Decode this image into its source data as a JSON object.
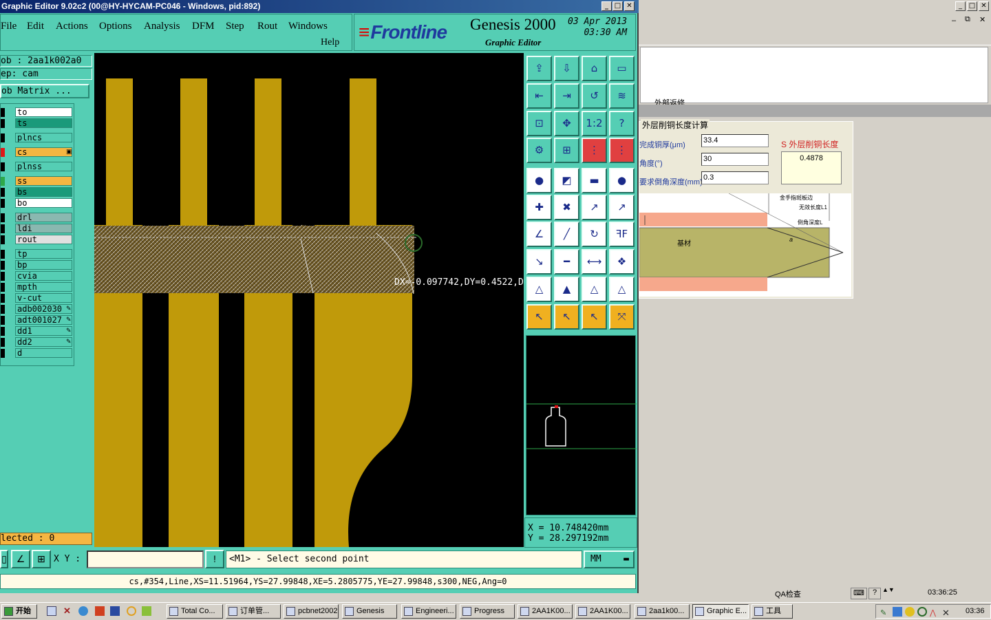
{
  "window": {
    "title": "Graphic Editor 9.02c2 (00@HY-HYCAM-PC046 - Windows, pid:892)",
    "controls": [
      "_",
      "□",
      "✕"
    ]
  },
  "menu": {
    "items": [
      "File",
      "Edit",
      "Actions",
      "Options",
      "Analysis",
      "DFM",
      "Step",
      "Rout",
      "Windows"
    ],
    "help": "Help"
  },
  "brand": {
    "logo": "Frontline",
    "product": "Genesis 2000",
    "subtitle": "Graphic Editor",
    "date": "03 Apr 2013",
    "time": "03:30 AM"
  },
  "job": {
    "job_line": "ob : 2aa1k002a0",
    "step_line": "ep: cam",
    "matrix_button": "ob Matrix ..."
  },
  "layers": [
    {
      "name": "to",
      "bg": "#ffffff",
      "sw": "#000000",
      "icon": ""
    },
    {
      "name": "ts",
      "bg": "#1a9a7a",
      "sw": "#000000",
      "icon": ""
    },
    {
      "name": "plncs",
      "bg": "#55ceb4",
      "sw": "#000000",
      "icon": ""
    },
    {
      "name": "cs",
      "bg": "#f5b642",
      "sw": "#e01818",
      "icon": "▣"
    },
    {
      "name": "plnss",
      "bg": "#55ceb4",
      "sw": "#000000",
      "icon": ""
    },
    {
      "name": "ss",
      "bg": "#f5b642",
      "sw": "#2ea84a",
      "icon": ""
    },
    {
      "name": "bs",
      "bg": "#1a9a7a",
      "sw": "#000000",
      "icon": ""
    },
    {
      "name": "bo",
      "bg": "#ffffff",
      "sw": "#000000",
      "icon": ""
    },
    {
      "name": "drl",
      "bg": "#8ab8b0",
      "sw": "#000000",
      "icon": ""
    },
    {
      "name": "ldi",
      "bg": "#8ab8b0",
      "sw": "#000000",
      "icon": ""
    },
    {
      "name": "rout",
      "bg": "#e0e0e0",
      "sw": "#000000",
      "icon": ""
    },
    {
      "name": "tp",
      "bg": "#55ceb4",
      "sw": "#000000",
      "icon": ""
    },
    {
      "name": "bp",
      "bg": "#55ceb4",
      "sw": "#000000",
      "icon": ""
    },
    {
      "name": "cvia",
      "bg": "#55ceb4",
      "sw": "#000000",
      "icon": ""
    },
    {
      "name": "mpth",
      "bg": "#55ceb4",
      "sw": "#000000",
      "icon": ""
    },
    {
      "name": "v-cut",
      "bg": "#55ceb4",
      "sw": "#000000",
      "icon": ""
    },
    {
      "name": "adb002030",
      "bg": "#55ceb4",
      "sw": "#000000",
      "icon": "✎"
    },
    {
      "name": "adt001027",
      "bg": "#55ceb4",
      "sw": "#000000",
      "icon": "✎"
    },
    {
      "name": "dd1",
      "bg": "#55ceb4",
      "sw": "#000000",
      "icon": "✎"
    },
    {
      "name": "dd2",
      "bg": "#55ceb4",
      "sw": "#000000",
      "icon": "✎"
    },
    {
      "name": "d",
      "bg": "#55ceb4",
      "sw": "#000000",
      "icon": ""
    }
  ],
  "selected": "lected : 0",
  "measure": "DX=-0.097742,DY=0.4522,D=0.4630675",
  "coords": {
    "x": "X =  10.748420mm",
    "y": "Y =  28.297192mm"
  },
  "command": {
    "xy_label": "X Y :",
    "xy_value": "",
    "prompt": "<M1> - Select second point",
    "units": "MM"
  },
  "status_line": "cs,#354,Line,XS=11.51964,YS=27.99848,XE=5.2805775,YE=27.99848,s300,NEG,Ang=0",
  "bgapp": {
    "tab_text": "外部返修",
    "calc_title": "外层削铜长度计算",
    "labels": [
      "完成铜厚(μm)",
      "角度(°)",
      "要求倒角深度(mm)"
    ],
    "values": [
      "33.4",
      "30",
      "0.3"
    ],
    "result_label": "S 外层削铜长度",
    "result_value": "0.4878",
    "diagram": {
      "substrate": "基材",
      "gold_edge": "金手指斑板边",
      "invalid_len": "无效长度L1",
      "chamfer_depth": "倒角深度L",
      "angle": "a"
    },
    "status_qa": "QA检查",
    "status_time": "03:36:25"
  },
  "taskbar": {
    "start": "开始",
    "tasks": [
      "Total Co...",
      "订单管...",
      "pcbnet2002",
      "Genesis",
      "Engineeri...",
      "Progress",
      "2AA1K00...",
      "2AA1K00...",
      "2aa1k00...",
      "Graphic E...",
      "工具"
    ],
    "clock": "03:36"
  },
  "colors": {
    "accent": "#55ceb4",
    "copper": "#c09a0a",
    "canvas": "#000000",
    "prompt_bg": "#fffbe6"
  }
}
